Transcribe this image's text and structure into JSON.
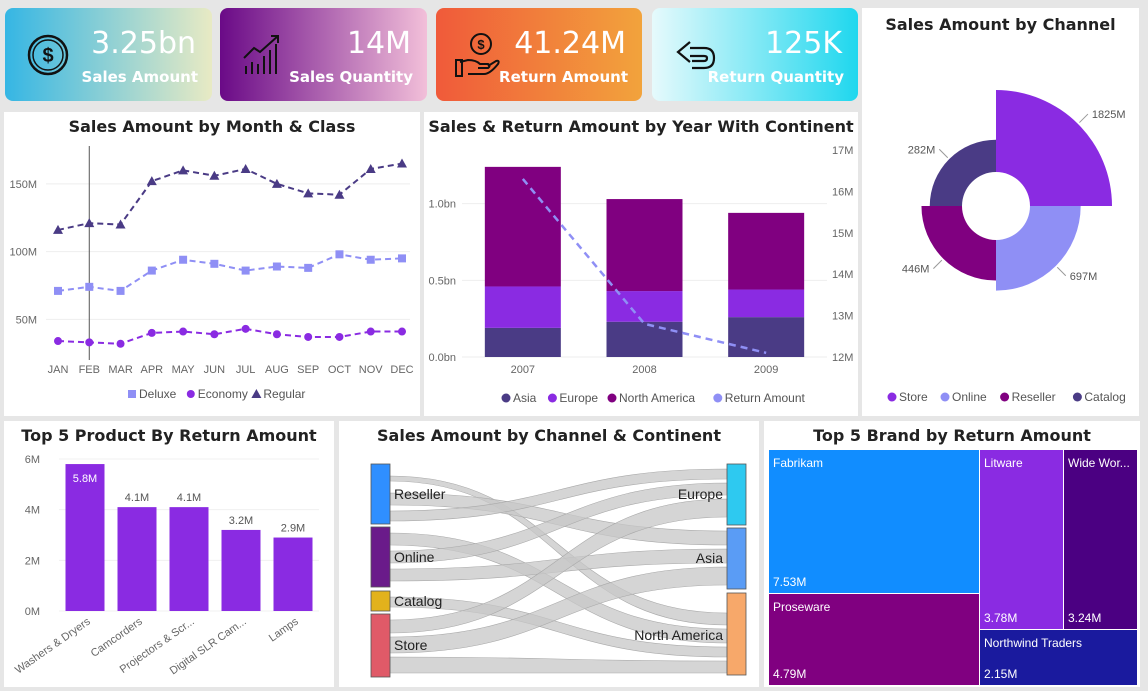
{
  "kpis": [
    {
      "value": "3.25bn",
      "label": "Sales Amount",
      "icon": "dollar-circle-icon",
      "gradient": [
        "#35b6e4",
        "#e8eac4"
      ]
    },
    {
      "value": "14M",
      "label": "Sales Quantity",
      "icon": "growth-chart-icon",
      "gradient": [
        "#6a0a87",
        "#f2bfd9"
      ]
    },
    {
      "value": "41.24M",
      "label": "Return Amount",
      "icon": "money-hand-icon",
      "gradient": [
        "#f05a3a",
        "#f2a33c"
      ]
    },
    {
      "value": "125K",
      "label": "Return Quantity",
      "icon": "return-arrow-icon",
      "gradient": [
        "#e6fafc",
        "#1fd7ee"
      ]
    }
  ],
  "colors": {
    "violet": "#8a2be2",
    "lavender": "#8f8ff5",
    "purple": "#800080",
    "indigo": "#4a3b85",
    "sankey_link": "#c7c7c7"
  },
  "chart_data": [
    {
      "id": "month_class",
      "type": "line",
      "title": "Sales Amount by Month & Class",
      "categories": [
        "JAN",
        "FEB",
        "MAR",
        "APR",
        "MAY",
        "JUN",
        "JUL",
        "AUG",
        "SEP",
        "OCT",
        "NOV",
        "DEC"
      ],
      "series": [
        {
          "name": "Regular",
          "marker": "triangle",
          "color": "#4a3b85",
          "values": [
            116,
            121,
            120,
            152,
            160,
            156,
            161,
            150,
            143,
            142,
            161,
            165
          ]
        },
        {
          "name": "Deluxe",
          "marker": "square",
          "color": "#8f8ff5",
          "values": [
            71,
            74,
            71,
            86,
            94,
            91,
            86,
            89,
            88,
            98,
            94,
            95
          ]
        },
        {
          "name": "Economy",
          "marker": "circle",
          "color": "#8a2be2",
          "values": [
            34,
            33,
            32,
            40,
            41,
            39,
            43,
            39,
            37,
            37,
            41,
            41
          ]
        }
      ],
      "yticks": [
        "50M",
        "100M",
        "150M"
      ],
      "ytick_values": [
        50,
        100,
        150
      ],
      "ylim": [
        20,
        175
      ],
      "legend": [
        "Deluxe",
        "Economy",
        "Regular"
      ],
      "legend_position": "bottom",
      "highlight_category": "FEB"
    },
    {
      "id": "year_continent",
      "type": "bar",
      "title": "Sales & Return Amount by Year With Continent",
      "categories": [
        "2007",
        "2008",
        "2009"
      ],
      "series": [
        {
          "name": "Asia",
          "color": "#4a3b85",
          "values": [
            0.19,
            0.23,
            0.26
          ]
        },
        {
          "name": "Europe",
          "color": "#8a2be2",
          "values": [
            0.27,
            0.2,
            0.18
          ]
        },
        {
          "name": "North America",
          "color": "#800080",
          "values": [
            0.78,
            0.6,
            0.5
          ]
        }
      ],
      "line_series": {
        "name": "Return Amount",
        "color": "#8f8ff5",
        "values": [
          16.3,
          12.8,
          12.1
        ]
      },
      "yticks_left": [
        "0.0bn",
        "0.5bn",
        "1.0bn"
      ],
      "ytick_values_left": [
        0,
        0.5,
        1.0
      ],
      "ylim_left": [
        0,
        1.35
      ],
      "yticks_right": [
        "12M",
        "13M",
        "14M",
        "15M",
        "16M",
        "17M"
      ],
      "ytick_values_right": [
        12,
        13,
        14,
        15,
        16,
        17
      ],
      "ylim_right": [
        12,
        17
      ],
      "legend": [
        "Asia",
        "Europe",
        "North America",
        "Return Amount"
      ],
      "legend_position": "bottom"
    },
    {
      "id": "channel",
      "type": "pie",
      "title": "Sales Amount by Channel",
      "labels": [
        "Store",
        "Online",
        "Reseller",
        "Catalog"
      ],
      "values": [
        1825,
        697,
        446,
        282
      ],
      "value_labels": [
        "1825M",
        "697M",
        "446M",
        "282M"
      ],
      "colors": [
        "#8a2be2",
        "#8f8ff5",
        "#800080",
        "#4a3b85"
      ],
      "legend": [
        "Store",
        "Online",
        "Reseller",
        "Catalog"
      ],
      "legend_position": "bottom"
    },
    {
      "id": "top_products",
      "type": "bar",
      "title": "Top 5 Product By Return Amount",
      "categories": [
        "Washers & Dryers",
        "Camcorders",
        "Projectors & Scr...",
        "Digital SLR Cam...",
        "Lamps"
      ],
      "values": [
        5.8,
        4.1,
        4.1,
        3.2,
        2.9
      ],
      "value_labels": [
        "5.8M",
        "4.1M",
        "4.1M",
        "3.2M",
        "2.9M"
      ],
      "color": "#8a2be2",
      "yticks": [
        "0M",
        "2M",
        "4M",
        "6M"
      ],
      "ytick_values": [
        0,
        2,
        4,
        6
      ],
      "ylim": [
        0,
        6
      ]
    },
    {
      "id": "channel_continent",
      "type": "sankey",
      "title": "Sales Amount by Channel & Continent",
      "sources": [
        {
          "name": "Reseller",
          "color": "#2f8fff"
        },
        {
          "name": "Online",
          "color": "#6a1b8a"
        },
        {
          "name": "Catalog",
          "color": "#e2b21c"
        },
        {
          "name": "Store",
          "color": "#e05a68"
        }
      ],
      "targets": [
        {
          "name": "Europe",
          "color": "#2ec9f0"
        },
        {
          "name": "Asia",
          "color": "#5a9cf5"
        },
        {
          "name": "North America",
          "color": "#f7a86a"
        }
      ]
    },
    {
      "id": "top_brands",
      "type": "treemap",
      "title": "Top 5 Brand by Return Amount",
      "labels": [
        "Fabrikam",
        "Proseware",
        "Litware",
        "Wide Wor...",
        "Northwind Traders"
      ],
      "values": [
        7.53,
        4.79,
        3.78,
        3.24,
        2.15
      ],
      "value_labels": [
        "7.53M",
        "4.79M",
        "3.78M",
        "3.24M",
        "2.15M"
      ],
      "colors": [
        "#118dff",
        "#800080",
        "#8a2be2",
        "#4b0082",
        "#1a1a9e"
      ]
    }
  ]
}
